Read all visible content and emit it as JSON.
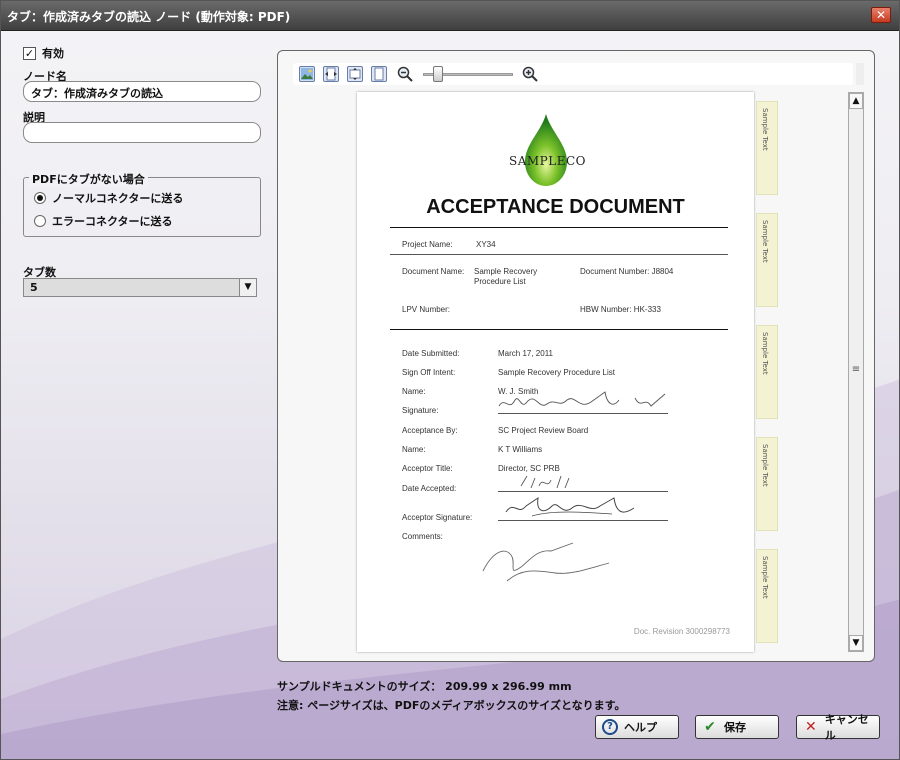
{
  "window": {
    "title": "タブ：作成済みタブの読込 ノード (動作対象: PDF)",
    "close_label": "✕"
  },
  "form": {
    "enabled_label": "有効",
    "enabled_check": "✓",
    "node_name_label": "ノード名",
    "node_name_value": "タブ：作成済みタブの読込",
    "description_label": "説明",
    "description_value": "",
    "no_tab_group_title": "PDFにタブがない場合",
    "radio_normal": "ノーマルコネクターに送る",
    "radio_error": "エラーコネクターに送る",
    "radio_selected": "normal",
    "tab_count_label": "タブ数",
    "tab_count_value": "5"
  },
  "preview": {
    "tab_label": "Sample Text",
    "zoom_out": "−",
    "zoom_in": "+",
    "scroll_up": "▲",
    "scroll_down": "▼",
    "grip": "≡",
    "document": {
      "logo_text": "SAMPLECO",
      "title": "ACCEPTANCE DOCUMENT",
      "project_name_label": "Project Name:",
      "project_name_value": "XY34",
      "document_name_label": "Document Name:",
      "document_name_value_1": "Sample Recovery",
      "document_name_value_2": "Procedure List",
      "document_number": "Document Number: J8804",
      "lpv_label": "LPV Number:",
      "hbw_number": "HBW Number: HK-333",
      "date_submitted_label": "Date Submitted:",
      "date_submitted_value": "March 17, 2011",
      "sign_off_label": "Sign Off Intent:",
      "sign_off_value": "Sample Recovery Procedure List",
      "name_label": "Name:",
      "name_value": "W. J. Smith",
      "signature_label": "Signature:",
      "acceptance_by_label": "Acceptance By:",
      "acceptance_by_value": "SC Project Review Board",
      "name2_label": "Name:",
      "name2_value": "K T Williams",
      "acceptor_title_label": "Acceptor Title:",
      "acceptor_title_value": "Director, SC PRB",
      "date_accepted_label": "Date Accepted:",
      "acceptor_signature_label": "Acceptor Signature:",
      "comments_label": "Comments:",
      "revision": "Doc. Revision 3000298773"
    }
  },
  "footer": {
    "size_text": "サンプルドキュメントのサイズ： 209.99 x 296.99 mm",
    "note_text": "注意: ページサイズは、PDFのメディアボックスのサイズとなります。",
    "help_label": "ヘルプ",
    "save_label": "保存",
    "cancel_label": "キャンセル"
  }
}
